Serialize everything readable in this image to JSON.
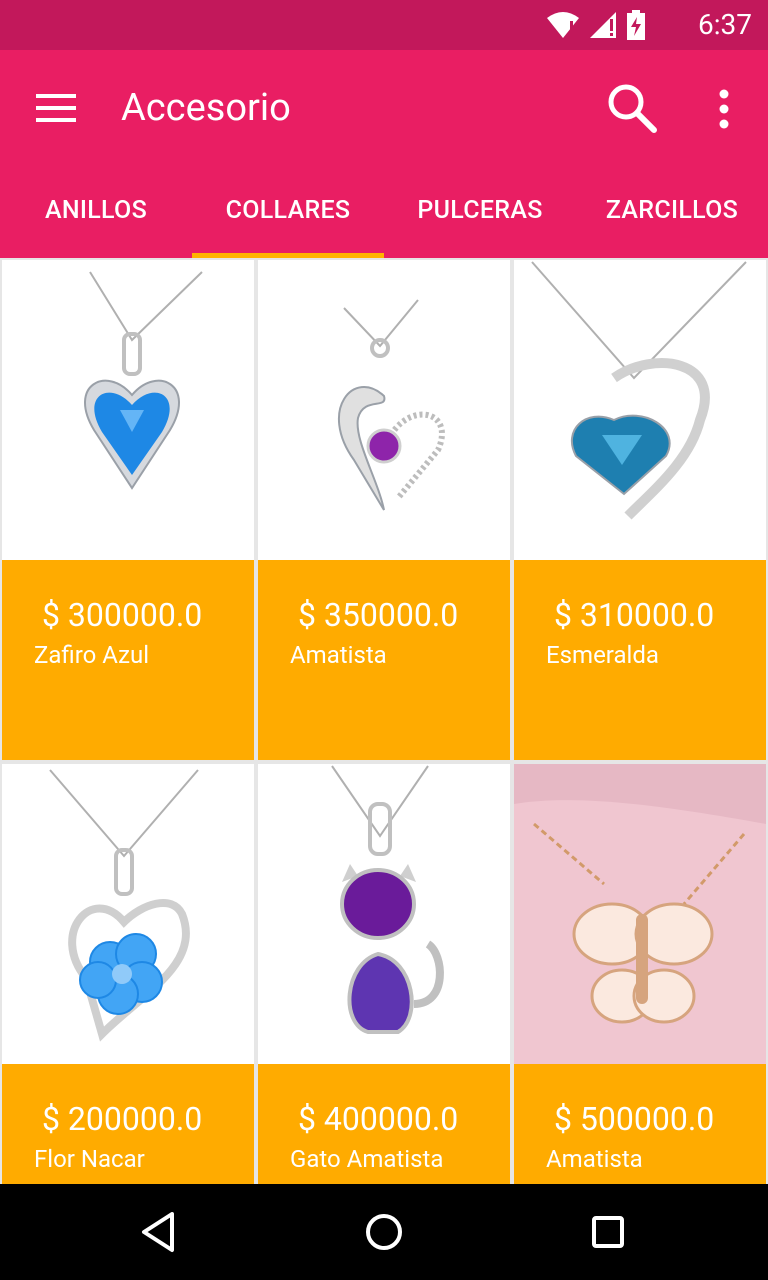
{
  "status": {
    "time": "6:37"
  },
  "app": {
    "title": "Accesorio"
  },
  "tabs": [
    {
      "label": "ANILLOS",
      "active": false
    },
    {
      "label": "COLLARES",
      "active": true
    },
    {
      "label": "PULCERAS",
      "active": false
    },
    {
      "label": "ZARCILLOS",
      "active": false
    }
  ],
  "products": [
    {
      "price": "$ 300000.0",
      "name": "Zafiro Azul",
      "image": "blue-heart-pendant"
    },
    {
      "price": "$ 350000.0",
      "name": "Amatista",
      "image": "purple-heart-pendant"
    },
    {
      "price": "$ 310000.0",
      "name": "Esmeralda",
      "image": "teal-heart-pendant"
    },
    {
      "price": "$ 200000.0",
      "name": "Flor Nacar",
      "image": "blue-flower-pendant"
    },
    {
      "price": "$ 400000.0",
      "name": "Gato Amatista",
      "image": "purple-cat-pendant"
    },
    {
      "price": "$ 500000.0",
      "name": "Amatista",
      "image": "butterfly-pendant"
    }
  ],
  "colors": {
    "status_bar": "#c2185b",
    "app_bar": "#e91e63",
    "tab_indicator": "#ffb300",
    "card_info": "#ffab00"
  }
}
